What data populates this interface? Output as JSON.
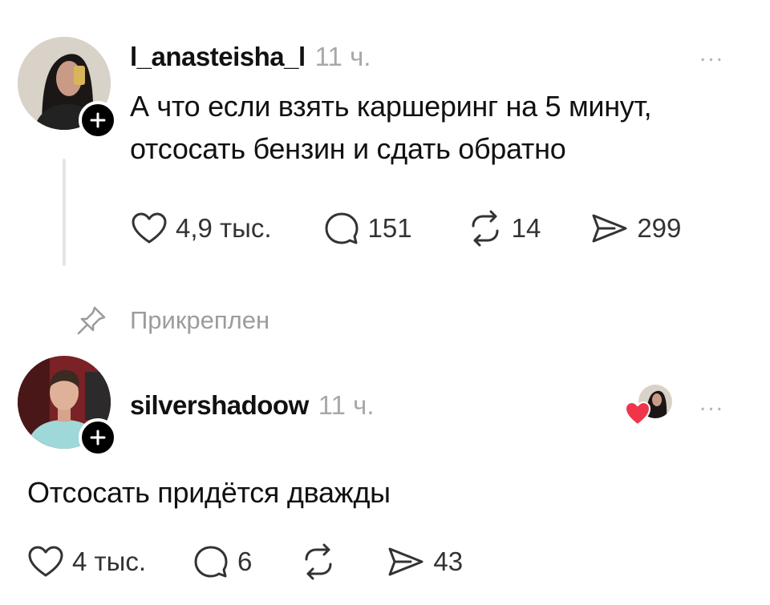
{
  "post": {
    "username": "l_anasteisha_l",
    "time": "11 ч.",
    "more": "...",
    "text_line1": "А что если взять каршеринг на 5 минут,",
    "text_line2": "отсосать бензин и сдать обратно",
    "actions": {
      "likes": "4,9 тыс.",
      "comments": "151",
      "reposts": "14",
      "shares": "299"
    }
  },
  "pinned_label": "Прикреплен",
  "reply": {
    "username": "silvershadoow",
    "time": "11 ч.",
    "more": "...",
    "text": "Отсосать придётся дважды",
    "actions": {
      "likes": "4 тыс.",
      "comments": "6",
      "shares": "43"
    }
  },
  "colors": {
    "text": "#111111",
    "muted": "#a8a8a8",
    "heart": "#f0354a",
    "badge": "#000000"
  },
  "icons": [
    "heart-icon",
    "comment-icon",
    "repost-icon",
    "share-icon",
    "pin-icon",
    "plus-icon"
  ]
}
